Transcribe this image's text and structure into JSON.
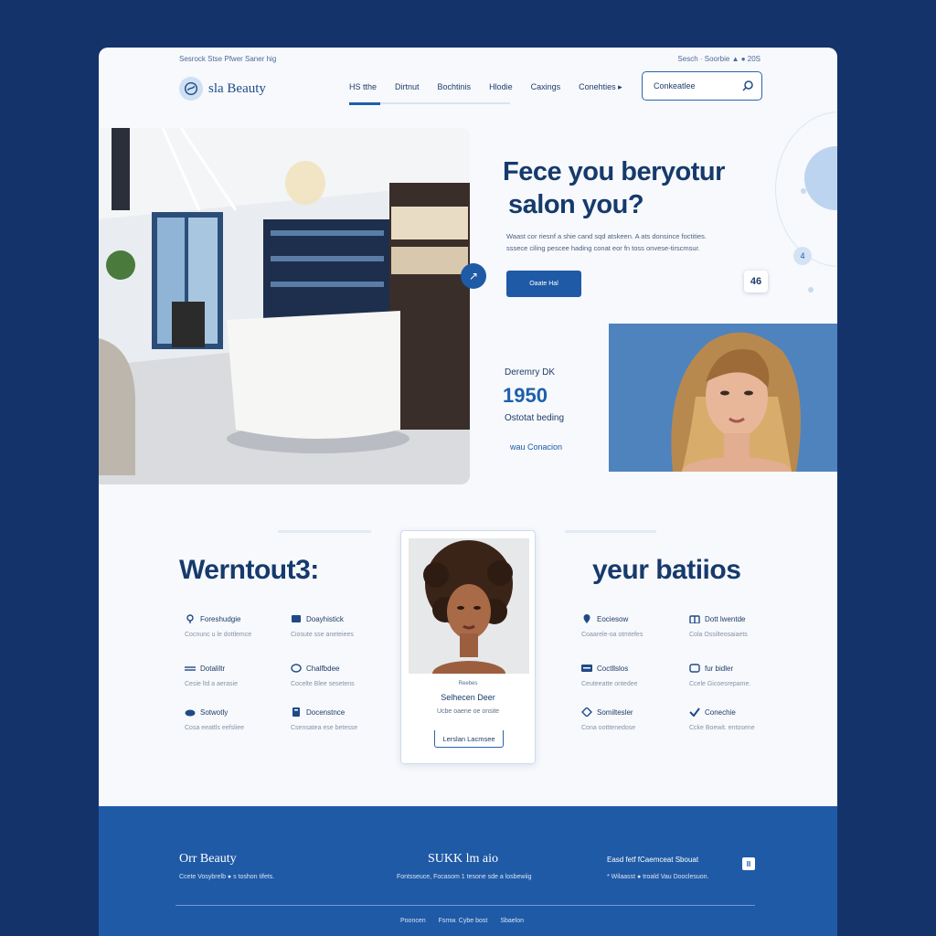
{
  "topbar": {
    "left": "Sesrock Stse Pfwer Saner hig",
    "right": "Sesch · Soorbie ▲ ● 20S"
  },
  "brand": {
    "name": "sla Beauty"
  },
  "nav": {
    "items": [
      "HS tthe",
      "Dirtnut",
      "Bochtinis",
      "Hlodie",
      "Caxings",
      "Conehties ▸"
    ]
  },
  "search": {
    "label": "Conkeatlee"
  },
  "hero": {
    "headline_1": "Fece you beryotur",
    "headline_2": "salon you?",
    "subcopy_1": "Waast cor riesnf a shie cand sqd atskeen. A ats donsince foctities.",
    "subcopy_2": "sssece ciling pescee hading conat eor fn toss onvese-tirscmsur.",
    "cta": "Oaate Hal",
    "badge": "46",
    "small_badge": "4",
    "arrow": "↗"
  },
  "stats": {
    "label": "Deremry DK",
    "value": "1950",
    "sub": "Ostotat beding",
    "link": "wau Conacion"
  },
  "services_left": {
    "title": "Werntout3:",
    "features": [
      {
        "name": "Foreshudgie",
        "desc": "Cocnunc u le dottlemce"
      },
      {
        "name": "Doayhistick",
        "desc": "Ciosute sse aneteiees"
      },
      {
        "name": "Dotaliltr",
        "desc": "Cesie ltd a aerasie"
      },
      {
        "name": "Chalfbdee",
        "desc": "Cocelte Blee sesetens"
      },
      {
        "name": "Sotwotly",
        "desc": "Cosa eeattls eefsliee"
      },
      {
        "name": "Docenstnce",
        "desc": "Csensatea ese betesse"
      }
    ]
  },
  "services_right": {
    "title": "yeur batiios",
    "features": [
      {
        "name": "Eociesow",
        "desc": "Coaarele-oa otmtefes"
      },
      {
        "name": "Dott lwentde",
        "desc": "Cola Ossilteosaiaets"
      },
      {
        "name": "Coctllslos",
        "desc": "Ceuteeatte ontedee"
      },
      {
        "name": "fur bidler",
        "desc": "Ccele Gicoesrepame."
      },
      {
        "name": "Somiltesler",
        "desc": "Cona ootttenedose"
      },
      {
        "name": "Conechie",
        "desc": "Ccke Boewit. entosene"
      }
    ]
  },
  "stylist_card": {
    "eyebrow": "Reebes",
    "name": "Selhecen Deer",
    "desc": "Ucbe oaene oe onsite",
    "button": "Lerslan Lacmsee"
  },
  "footer": {
    "col1_title": "Orr Beauty",
    "col1_text": "Ccete Vosybrelb ● s toshon tifets.",
    "col2_title": "SUKK lm aio",
    "col2_text": "Fontsseuce, Focasom 1 tesone sde a losbewiig",
    "col3_title": "Easd fetf fCaemceat Sbouat",
    "col3_text": "* Wilaasst ● troald Vau Dooclesuon.",
    "icon": "II",
    "links": [
      "Pooncen",
      "Fsmw. Cybe bost",
      "Sbaelon"
    ]
  },
  "colors": {
    "navy": "#14336b",
    "brand_blue": "#1f5aa6",
    "heading": "#163a6b"
  }
}
